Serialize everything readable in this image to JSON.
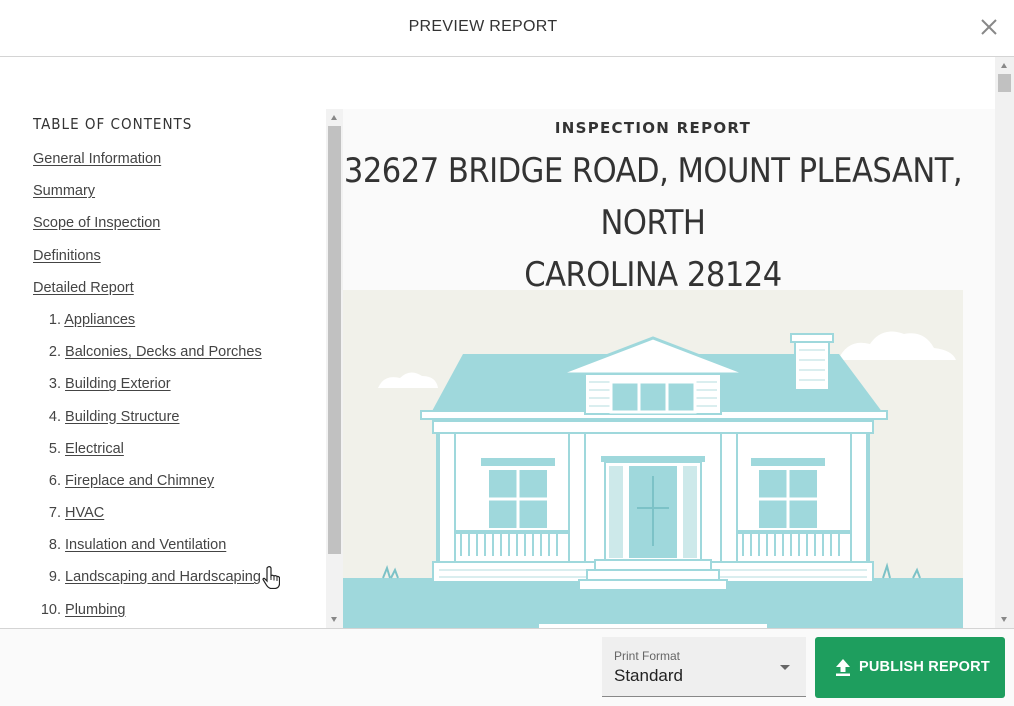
{
  "dialog": {
    "title": "PREVIEW REPORT",
    "close_icon": "close-icon"
  },
  "toc": {
    "heading": "TABLE OF CONTENTS",
    "items": [
      {
        "num": "",
        "label": "General Information"
      },
      {
        "num": "",
        "label": "Summary"
      },
      {
        "num": "",
        "label": "Scope of Inspection"
      },
      {
        "num": "",
        "label": "Definitions"
      },
      {
        "num": "",
        "label": "Detailed Report"
      },
      {
        "num": "1.",
        "label": "Appliances"
      },
      {
        "num": "2.",
        "label": "Balconies, Decks and Porches"
      },
      {
        "num": "3.",
        "label": "Building Exterior"
      },
      {
        "num": "4.",
        "label": "Building Structure"
      },
      {
        "num": "5.",
        "label": "Electrical"
      },
      {
        "num": "6.",
        "label": "Fireplace and Chimney"
      },
      {
        "num": "7.",
        "label": "HVAC"
      },
      {
        "num": "8.",
        "label": "Insulation and Ventilation"
      },
      {
        "num": "9.",
        "label": "Landscaping and Hardscaping"
      },
      {
        "num": "10.",
        "label": "Plumbing"
      }
    ]
  },
  "preview": {
    "kicker": "INSPECTION REPORT",
    "address_line1": "32627 BRIDGE ROAD, MOUNT PLEASANT, NORTH",
    "address_line2": "CAROLINA 28124",
    "cover_image": "house-illustration"
  },
  "footer": {
    "print_format": {
      "label": "Print Format",
      "value": "Standard"
    },
    "publish_label": "PUBLISH REPORT"
  },
  "colors": {
    "accent_green": "#1e9e5e",
    "house_teal": "#9fd8dc"
  }
}
